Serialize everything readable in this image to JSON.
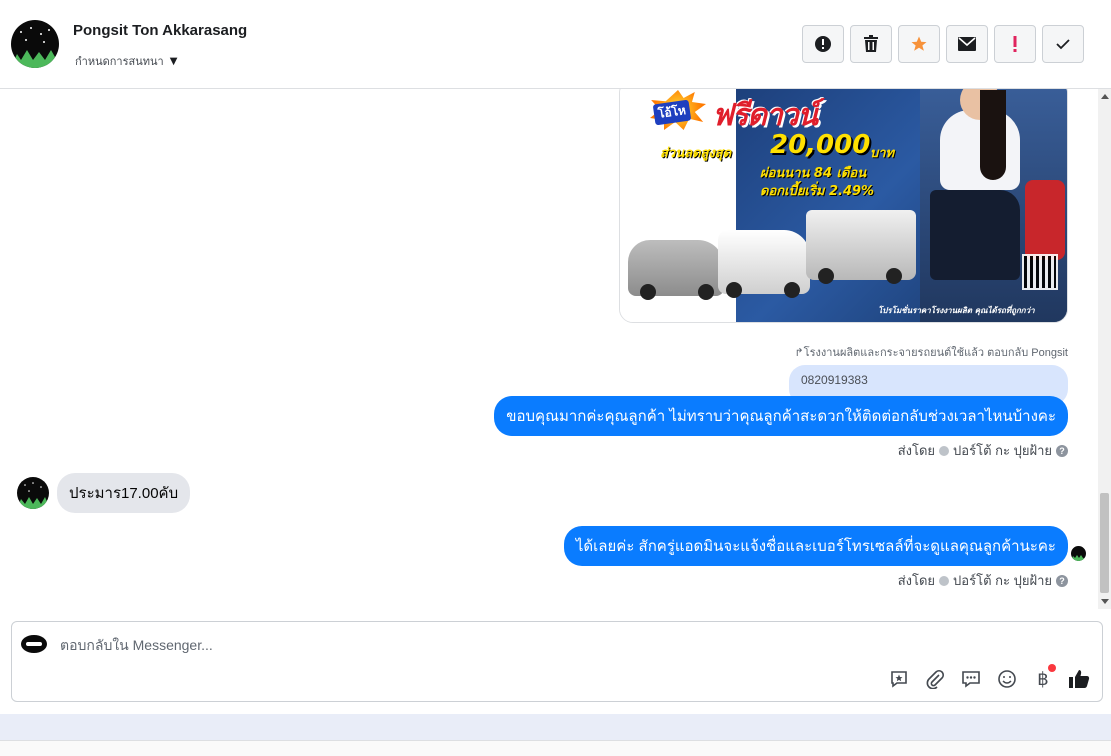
{
  "header": {
    "contact_name": "Pongsit Ton Akkarasang",
    "assign_label": "กำหนดการสนทนา",
    "actions": [
      {
        "icon": "alert-circle-icon"
      },
      {
        "icon": "trash-icon"
      },
      {
        "icon": "star-icon"
      },
      {
        "icon": "envelope-icon"
      },
      {
        "icon": "exclamation-icon"
      },
      {
        "icon": "check-icon"
      }
    ]
  },
  "promo": {
    "badge_text": "โอ้โห",
    "headline": "ฟรีดาวน์",
    "discount_label": "ส่วนลดสูงสุด",
    "discount_value": "20,000",
    "discount_unit": "บาท",
    "installment": "ผ่อนนาน 84 เดือน",
    "interest": "ดอกเบี้ยเริ่ม 2.49%",
    "footer": "โปรโมชั่นราคาโรงงานผลิต คุณได้รถที่ถูกกว่า"
  },
  "messages": {
    "reply_note": "↱โรงงานผลิตและกระจายรถยนต์ใช้แล้ว ตอบกลับ Pongsit",
    "quoted": "0820919383",
    "out1": "ขอบคุณมากค่ะคุณลูกค้า ไม่ทราบว่าคุณลูกค้าสะดวกให้ติดต่อกลับช่วงเวลาไหนบ้างคะ",
    "sent_by_prefix": "ส่งโดย",
    "sent_by_name": "ปอร์โต้ กะ ปุยฝ้าย",
    "in1": "ประมาร17.00คับ",
    "out2": "ได้เลยค่ะ สักครู่แอดมินจะแจ้งชื่อและเบอร์โทรเซลล์ที่จะดูแลคุณลูกค้านะคะ"
  },
  "composer": {
    "placeholder": "ตอบกลับใน Messenger...",
    "tools": [
      "saved-reply-icon",
      "paperclip-icon",
      "chat-bubbles-icon",
      "emoji-icon",
      "baht-icon",
      "thumbs-up-icon"
    ]
  },
  "colors": {
    "outgoing_bubble": "#0a7cff",
    "incoming_bubble": "#e4e6eb",
    "quoted_bubble": "#d8e5fd",
    "star": "#f7923a",
    "exclamation": "#e0245e"
  }
}
